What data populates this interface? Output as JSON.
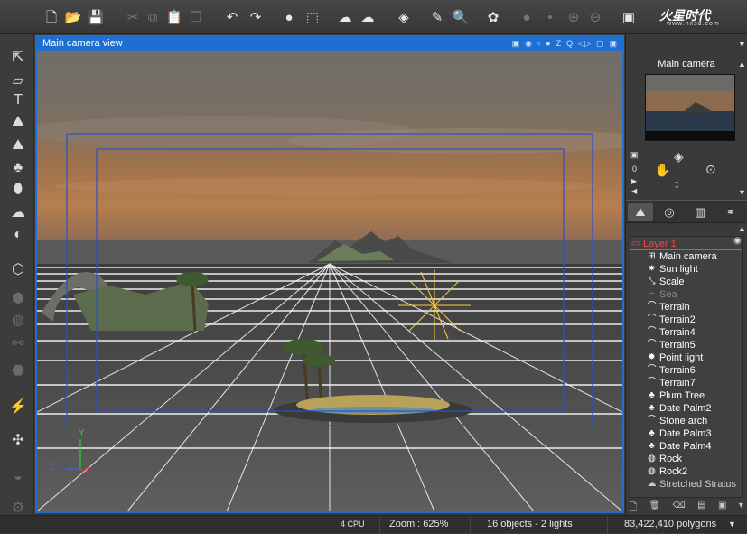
{
  "toolbar": {
    "buttons": [
      {
        "name": "new-file-icon",
        "glyph": "🗋"
      },
      {
        "name": "open-folder-icon",
        "glyph": "📂"
      },
      {
        "name": "save-icon",
        "glyph": "💾"
      },
      {
        "name": "cut-icon",
        "glyph": "✂"
      },
      {
        "name": "copy-icon",
        "glyph": "⧉"
      },
      {
        "name": "paste-icon",
        "glyph": "📋"
      },
      {
        "name": "duplicate-icon",
        "glyph": "❐"
      },
      {
        "name": "undo-icon",
        "glyph": "↶"
      },
      {
        "name": "redo-icon",
        "glyph": "↷"
      },
      {
        "name": "render-icon",
        "glyph": "●"
      },
      {
        "name": "render-area-icon",
        "glyph": "⬚"
      },
      {
        "name": "atmosphere-icon",
        "glyph": "☁"
      },
      {
        "name": "clouds-icon",
        "glyph": "☁"
      },
      {
        "name": "material-icon",
        "glyph": "◈"
      },
      {
        "name": "wand-icon",
        "glyph": "✎"
      },
      {
        "name": "edit-icon",
        "glyph": "🔍"
      },
      {
        "name": "color-balls-icon",
        "glyph": "✿"
      },
      {
        "name": "spheres-icon",
        "glyph": "●"
      },
      {
        "name": "dot-icon",
        "glyph": "•"
      },
      {
        "name": "plus-icon",
        "glyph": "⊕"
      },
      {
        "name": "minus-icon",
        "glyph": "⊖"
      },
      {
        "name": "layout-icon",
        "glyph": "▣"
      }
    ],
    "brand_main": "火星时代",
    "brand_sub": "www.hxsd.com"
  },
  "left_toolbar": {
    "buttons": [
      {
        "name": "select-tool-icon",
        "glyph": "⇱"
      },
      {
        "name": "eraser-tool-icon",
        "glyph": "▱"
      },
      {
        "name": "text-tool-icon",
        "glyph": "T"
      },
      {
        "name": "terrain-tool-icon",
        "glyph": "⛰"
      },
      {
        "name": "terrain-alt-tool-icon",
        "glyph": "⛰"
      },
      {
        "name": "plant-tool-icon",
        "glyph": "♣"
      },
      {
        "name": "rock-tool-icon",
        "glyph": "⬮"
      },
      {
        "name": "cloud-tool-icon",
        "glyph": "☁"
      },
      {
        "name": "planet-tool-icon",
        "glyph": "◐"
      },
      {
        "name": "object-tool-icon",
        "glyph": "⬡"
      },
      {
        "name": "cube-tool-icon",
        "glyph": "⬢"
      },
      {
        "name": "sphere-tool-icon",
        "glyph": "◍"
      },
      {
        "name": "link-tool-icon",
        "glyph": "⚯"
      },
      {
        "name": "group-tool-icon",
        "glyph": "⬣"
      },
      {
        "name": "wand-tool-icon",
        "glyph": "⚡"
      },
      {
        "name": "fan-tool-icon",
        "glyph": "✣"
      },
      {
        "name": "boolean-tool-icon",
        "glyph": "◒"
      },
      {
        "name": "settings-tool-icon",
        "glyph": "⚙"
      }
    ]
  },
  "viewport": {
    "title": "Main camera view",
    "icons": [
      "▣",
      "◉",
      "▫",
      "●",
      "Z",
      "Q",
      "◁▷",
      "▢",
      "▣"
    ],
    "axis_labels": {
      "x": "X",
      "y": "Y",
      "z": "Z"
    }
  },
  "right_panel": {
    "camera_title": "Main camera",
    "nav": {
      "zero_label": "0"
    },
    "tabs": [
      {
        "name": "tab-objects",
        "glyph": "⛰"
      },
      {
        "name": "tab-materials",
        "glyph": "◎"
      },
      {
        "name": "tab-library",
        "glyph": "▥"
      },
      {
        "name": "tab-links",
        "glyph": "⚭"
      }
    ],
    "tree": [
      {
        "label": "Layer 1",
        "icon": "▭",
        "indent": 2,
        "color": "#ff4040"
      },
      {
        "label": "Main camera",
        "icon": "⊞",
        "indent": 20,
        "color": "#ffffff"
      },
      {
        "label": "Sun light",
        "icon": "✷",
        "indent": 20,
        "color": "#ffffff"
      },
      {
        "label": "Scale",
        "icon": "⤡",
        "indent": 20,
        "color": "#ffffff"
      },
      {
        "label": "Sea",
        "icon": "~",
        "indent": 20,
        "color": "#888888"
      },
      {
        "label": "Terrain",
        "icon": "⌒",
        "indent": 20,
        "color": "#ffffff"
      },
      {
        "label": "Terrain2",
        "icon": "⌒",
        "indent": 20,
        "color": "#ffffff"
      },
      {
        "label": "Terrain4",
        "icon": "⌒",
        "indent": 20,
        "color": "#ffffff"
      },
      {
        "label": "Terrain5",
        "icon": "⌒",
        "indent": 20,
        "color": "#ffffff"
      },
      {
        "label": "Point light",
        "icon": "✹",
        "indent": 20,
        "color": "#ffffff"
      },
      {
        "label": "Terrain6",
        "icon": "⌒",
        "indent": 20,
        "color": "#ffffff"
      },
      {
        "label": "Terrain7",
        "icon": "⌒",
        "indent": 20,
        "color": "#ffffff"
      },
      {
        "label": "Plum Tree",
        "icon": "♣",
        "indent": 20,
        "color": "#ffffff"
      },
      {
        "label": "Date Palm2",
        "icon": "♣",
        "indent": 20,
        "color": "#ffffff"
      },
      {
        "label": "Stone arch",
        "icon": "⌒",
        "indent": 20,
        "color": "#ffffff"
      },
      {
        "label": "Date Palm3",
        "icon": "♣",
        "indent": 20,
        "color": "#ffffff"
      },
      {
        "label": "Date Palm4",
        "icon": "♣",
        "indent": 20,
        "color": "#ffffff"
      },
      {
        "label": "Rock",
        "icon": "◍",
        "indent": 20,
        "color": "#ffffff"
      },
      {
        "label": "Rock2",
        "icon": "◍",
        "indent": 20,
        "color": "#ffffff"
      },
      {
        "label": "Stretched Stratus",
        "icon": "☁",
        "indent": 20,
        "color": "#cccccc"
      }
    ],
    "bottom_tools": [
      "🗋",
      "🗑",
      "⌫",
      "▤",
      "▣",
      "▾"
    ]
  },
  "statusbar": {
    "cpu": "4 CPU",
    "zoom": "Zoom : 625%",
    "objects": "16 objects - 2 lights",
    "polygons": "83,422,410 polygons"
  },
  "colors": {
    "accent": "#1f6fd0",
    "layer_red": "#ff4040",
    "grid": "#ffffff"
  }
}
